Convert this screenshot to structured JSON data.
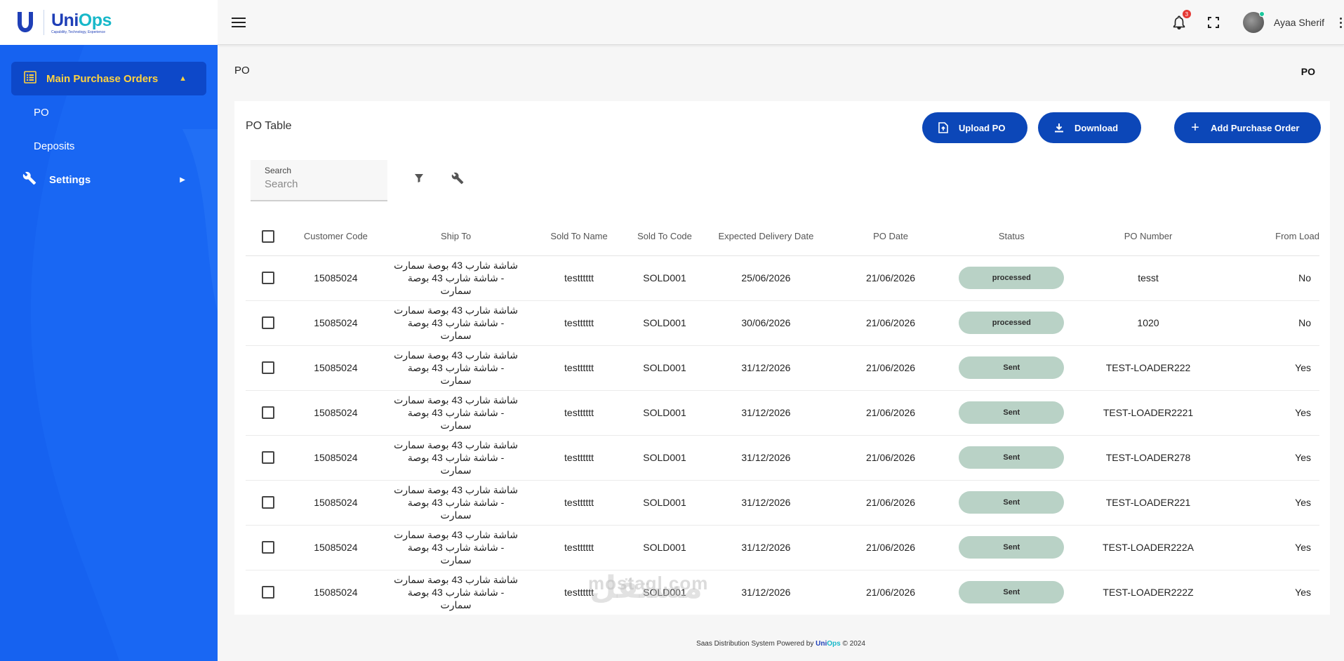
{
  "app": {
    "logo_name": "UniOps",
    "logo_name_a": "Uni",
    "logo_name_b": "Ops",
    "logo_tagline": "Capability, Technology, Experience",
    "logo_brand_mark": "Unilever"
  },
  "sidebar": {
    "group_label": "Main Purchase Orders",
    "items": [
      {
        "label": "PO"
      },
      {
        "label": "Deposits"
      }
    ],
    "settings_label": "Settings"
  },
  "header": {
    "notifications_count": "3",
    "username": "Ayaa Sherif"
  },
  "page": {
    "title": "PO",
    "breadcrumb": "PO"
  },
  "card": {
    "title": "PO Table",
    "upload_label": "Upload PO",
    "download_label": "Download",
    "add_label": "Add Purchase Order",
    "search_label": "Search",
    "search_placeholder": "Search"
  },
  "table": {
    "columns": [
      "Customer Code",
      "Ship To",
      "Sold To Name",
      "Sold To Code",
      "Expected Delivery Date",
      "PO Date",
      "Status",
      "PO Number",
      "From Load"
    ],
    "rows": [
      {
        "customer_code": "15085024",
        "ship_to": "شاشة شارب 43 بوصة سمارت - شاشة شارب 43 بوصة سمارت",
        "sold_to_name": "testttttt",
        "sold_to_code": "SOLD001",
        "expected_delivery": "25/06/2026",
        "po_date": "21/06/2026",
        "status": "processed",
        "po_number": "tesst",
        "from_load": "No"
      },
      {
        "customer_code": "15085024",
        "ship_to": "شاشة شارب 43 بوصة سمارت - شاشة شارب 43 بوصة سمارت",
        "sold_to_name": "testttttt",
        "sold_to_code": "SOLD001",
        "expected_delivery": "30/06/2026",
        "po_date": "21/06/2026",
        "status": "processed",
        "po_number": "1020",
        "from_load": "No"
      },
      {
        "customer_code": "15085024",
        "ship_to": "شاشة شارب 43 بوصة سمارت - شاشة شارب 43 بوصة سمارت",
        "sold_to_name": "testttttt",
        "sold_to_code": "SOLD001",
        "expected_delivery": "31/12/2026",
        "po_date": "21/06/2026",
        "status": "Sent",
        "po_number": "TEST-LOADER222",
        "from_load": "Yes"
      },
      {
        "customer_code": "15085024",
        "ship_to": "شاشة شارب 43 بوصة سمارت - شاشة شارب 43 بوصة سمارت",
        "sold_to_name": "testttttt",
        "sold_to_code": "SOLD001",
        "expected_delivery": "31/12/2026",
        "po_date": "21/06/2026",
        "status": "Sent",
        "po_number": "TEST-LOADER2221",
        "from_load": "Yes"
      },
      {
        "customer_code": "15085024",
        "ship_to": "شاشة شارب 43 بوصة سمارت - شاشة شارب 43 بوصة سمارت",
        "sold_to_name": "testttttt",
        "sold_to_code": "SOLD001",
        "expected_delivery": "31/12/2026",
        "po_date": "21/06/2026",
        "status": "Sent",
        "po_number": "TEST-LOADER278",
        "from_load": "Yes"
      },
      {
        "customer_code": "15085024",
        "ship_to": "شاشة شارب 43 بوصة سمارت - شاشة شارب 43 بوصة سمارت",
        "sold_to_name": "testttttt",
        "sold_to_code": "SOLD001",
        "expected_delivery": "31/12/2026",
        "po_date": "21/06/2026",
        "status": "Sent",
        "po_number": "TEST-LOADER221",
        "from_load": "Yes"
      },
      {
        "customer_code": "15085024",
        "ship_to": "شاشة شارب 43 بوصة سمارت - شاشة شارب 43 بوصة سمارت",
        "sold_to_name": "testttttt",
        "sold_to_code": "SOLD001",
        "expected_delivery": "31/12/2026",
        "po_date": "21/06/2026",
        "status": "Sent",
        "po_number": "TEST-LOADER222A",
        "from_load": "Yes"
      },
      {
        "customer_code": "15085024",
        "ship_to": "شاشة شارب 43 بوصة سمارت - شاشة شارب 43 بوصة سمارت",
        "sold_to_name": "testttttt",
        "sold_to_code": "SOLD001",
        "expected_delivery": "31/12/2026",
        "po_date": "21/06/2026",
        "status": "Sent",
        "po_number": "TEST-LOADER222Z",
        "from_load": "Yes"
      }
    ]
  },
  "watermark": {
    "arabic": "مستقل",
    "latin": "mostaql.com"
  },
  "footer": {
    "text": "Saas Distribution System Powered by",
    "brand_a": "Uni",
    "brand_b": "Ops",
    "copyright": "© 2024"
  },
  "colors": {
    "sidebar": "#1662f0",
    "active_group": "#0d48c9",
    "accent_yellow": "#ffd23f",
    "button": "#0c47b8",
    "status_pill": "#b9d2c6"
  }
}
